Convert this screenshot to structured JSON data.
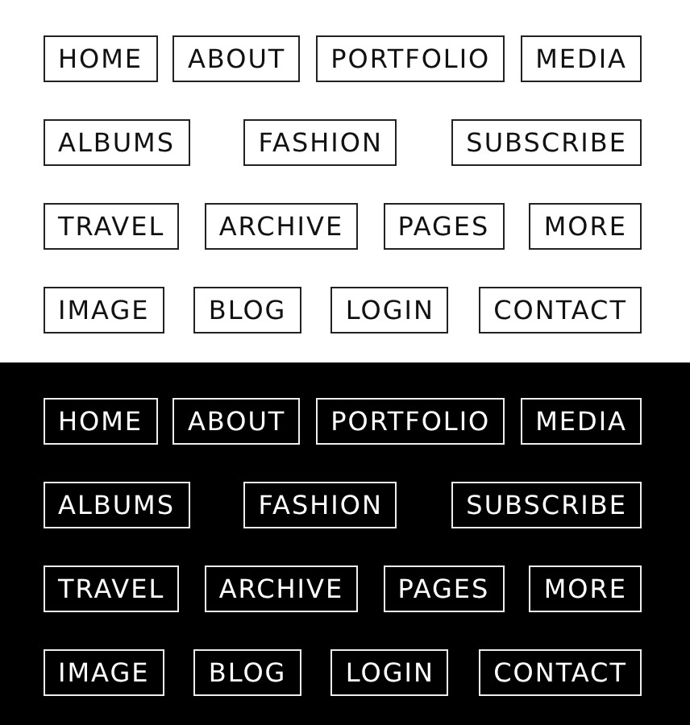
{
  "panels": [
    {
      "dark": false,
      "rows": [
        [
          "HOME",
          "ABOUT",
          "PORTFOLIO",
          "MEDIA"
        ],
        [
          "ALBUMS",
          "FASHION",
          "SUBSCRIBE"
        ],
        [
          "TRAVEL",
          "ARCHIVE",
          "PAGES",
          "MORE"
        ],
        [
          "IMAGE",
          "BLOG",
          "LOGIN",
          "CONTACT"
        ]
      ]
    },
    {
      "dark": true,
      "rows": [
        [
          "HOME",
          "ABOUT",
          "PORTFOLIO",
          "MEDIA"
        ],
        [
          "ALBUMS",
          "FASHION",
          "SUBSCRIBE"
        ],
        [
          "TRAVEL",
          "ARCHIVE",
          "PAGES",
          "MORE"
        ],
        [
          "IMAGE",
          "BLOG",
          "LOGIN",
          "CONTACT"
        ]
      ]
    }
  ]
}
